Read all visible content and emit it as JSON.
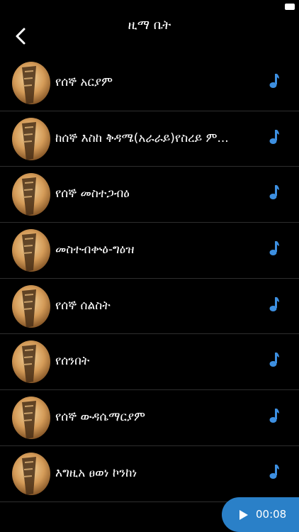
{
  "header": {
    "title": "ዚማ ቤት",
    "back_icon": "chevron-left-icon"
  },
  "items": [
    {
      "label": "የሰኞ አርያም"
    },
    {
      "label": "ከሰኞ እስከ ቅዳሜ(አራራይ)የስረይ ም..."
    },
    {
      "label": "የሰኞ መስተጋብዕ"
    },
    {
      "label": "መስተብቍዕ-ግዕዝ"
    },
    {
      "label": "የሰኞ ሰልስት"
    },
    {
      "label": "የሰንበት"
    },
    {
      "label": "የሰኞ ውዳሴማርያም"
    },
    {
      "label": "እግዚአ ፀወነ ኮንከነ"
    }
  ],
  "player": {
    "time": "00:08",
    "icon": "play-icon"
  },
  "colors": {
    "accent": "#2a80c8",
    "icon_blue": "#3d8fe0",
    "background": "#000000"
  }
}
